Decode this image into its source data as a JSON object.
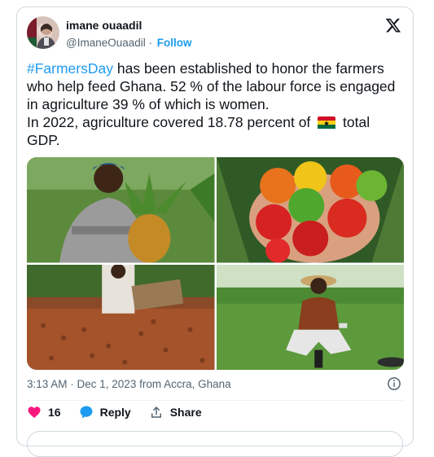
{
  "author": {
    "name": "imane ouaadil",
    "handle": "@ImaneOuaadil",
    "follow_label": "Follow"
  },
  "tweet": {
    "hashtag": "#FarmersDay",
    "line1_rest": " has been established to honor the farmers who help feed Ghana. 52 % of the labour force is engaged in agriculture 39 % of which is women.",
    "line2_before_flag": "In 2022, agriculture covered 18.78 percent of",
    "line2_after_flag": "total GDP."
  },
  "meta": {
    "timestamp": "3:13 AM · Dec 1, 2023 from Accra, Ghana"
  },
  "actions": {
    "like_count": "16",
    "reply_label": "Reply",
    "share_label": "Share"
  },
  "media": [
    {
      "name": "woman-with-pineapple-photo"
    },
    {
      "name": "hot-peppers-photo"
    },
    {
      "name": "cocoa-beans-drying-photo"
    },
    {
      "name": "farmer-working-field-photo"
    }
  ],
  "icons": {
    "x_logo": "x-logo-icon",
    "info": "info-icon",
    "like": "heart-icon",
    "reply": "speech-bubble-icon",
    "share": "share-icon",
    "flag": "ghana-flag-icon"
  },
  "colors": {
    "accent": "#1d9bf0",
    "like": "#f91880",
    "text": "#0f1419",
    "muted": "#536471"
  }
}
